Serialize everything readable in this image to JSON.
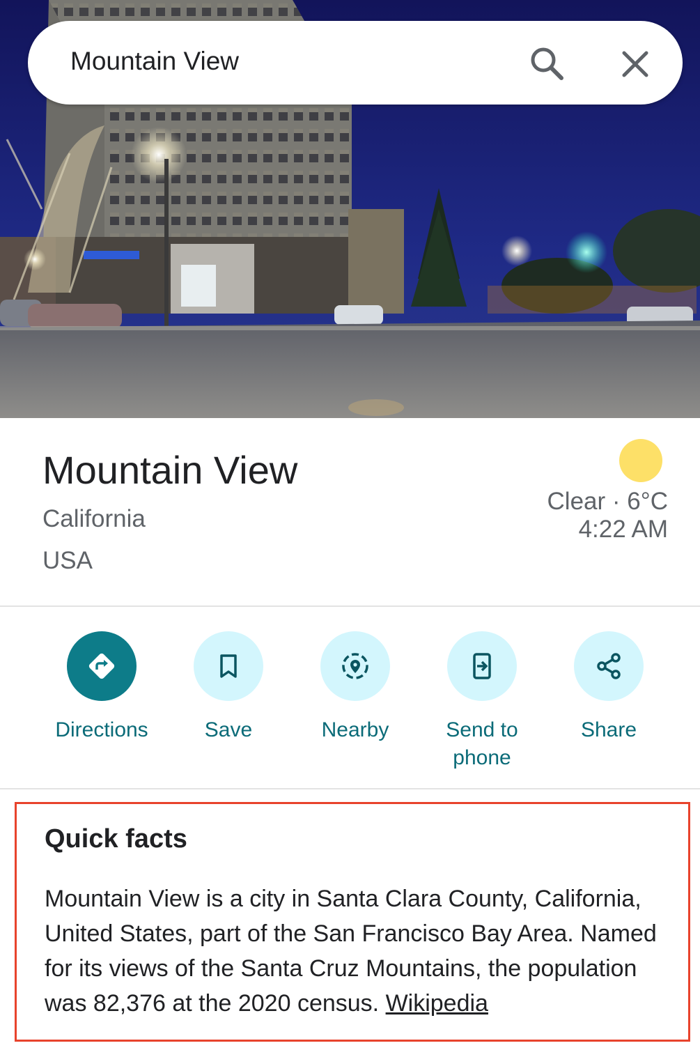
{
  "search": {
    "query": "Mountain View"
  },
  "place": {
    "title": "Mountain View",
    "region": "California",
    "country": "USA"
  },
  "weather": {
    "condition": "Clear · 6°C",
    "local_time": "4:22 AM",
    "icon": "sun-icon",
    "icon_color": "#fde068"
  },
  "actions": [
    {
      "label": "Directions",
      "icon": "directions-icon",
      "primary": true
    },
    {
      "label": "Save",
      "icon": "bookmark-icon",
      "primary": false
    },
    {
      "label": "Nearby",
      "icon": "nearby-icon",
      "primary": false
    },
    {
      "label": "Send to phone",
      "icon": "send-to-phone-icon",
      "primary": false
    },
    {
      "label": "Share",
      "icon": "share-icon",
      "primary": false
    }
  ],
  "quick_facts": {
    "title": "Quick facts",
    "text": "Mountain View is a city in Santa Clara County, California, United States, part of the San Francisco Bay Area. Named for its views of the Santa Cruz Mountains, the population was 82,376 at the 2020 census.",
    "source_link": "Wikipedia"
  },
  "colors": {
    "accent": "#0d7c89",
    "action_bg": "#d3f6fd",
    "action_label": "#0b6b78",
    "highlight_border": "#e8432c"
  }
}
